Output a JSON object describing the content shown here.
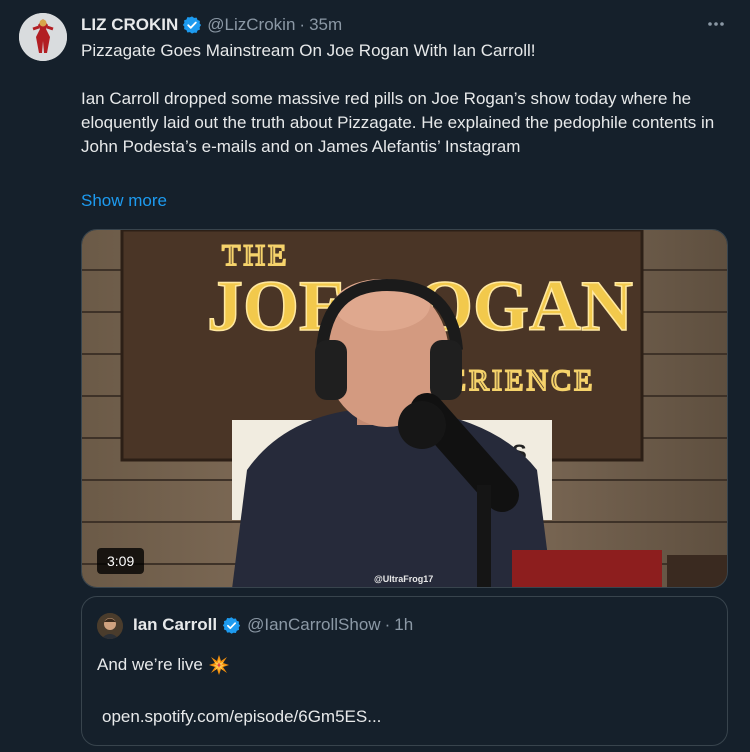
{
  "tweet": {
    "author_name": "LIZ CROKIN",
    "author_handle": "@LizCrokin",
    "time": "35m",
    "separator": "·",
    "text": "Pizzagate Goes Mainstream On Joe Rogan With Ian Carroll!\n\nIan Carroll dropped some massive red pills on Joe Rogan’s show today where he eloquently laid out the truth about Pizzagate. He explained the pedophile contents in John Podesta’s e-mails and on James Alefantis’ Instagram",
    "show_more": "Show more",
    "more_icon": "more-horizontal-icon"
  },
  "media": {
    "duration": "3:09",
    "sign_top": "THE",
    "sign_main": "JOE ROGAN",
    "sign_bottom": "EXPERIENCE",
    "sign_fragment": "S",
    "watermark": "@UltraFrog17"
  },
  "quote": {
    "author_name": "Ian Carroll",
    "author_handle": "@IanCarrollShow",
    "separator": "·",
    "time": "1h",
    "text": "And we’re live",
    "text_icon": "collision-emoji-icon",
    "link": "open.spotify.com/episode/6Gm5ES..."
  },
  "colors": {
    "background": "#15202b",
    "accent": "#1d9bf0",
    "text": "#e7e9ea",
    "muted": "#8b98a5",
    "border": "#38444d"
  }
}
